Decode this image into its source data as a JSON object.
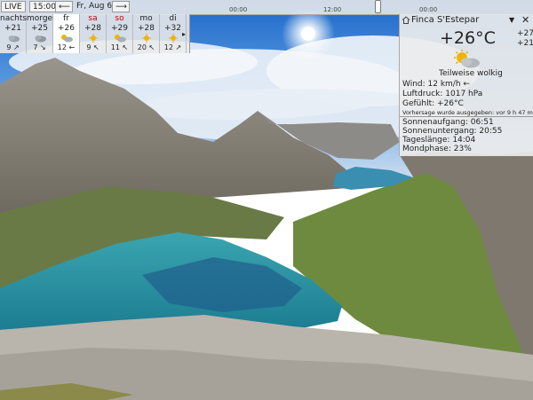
{
  "top": {
    "live_label": "LIVE",
    "time": "15:00",
    "prev_arrow": "⟵",
    "date": "Fr, Aug 6",
    "next_arrow": "⟶",
    "ticks": [
      "00:00",
      "12:00",
      "00:00"
    ]
  },
  "forecast": [
    {
      "name": "nachts",
      "temp": "+21",
      "wind_speed": "9",
      "wind_dir": "↗",
      "icon": "cloud-icon",
      "weekend": false,
      "selected": false
    },
    {
      "name": "morgen",
      "temp": "+25",
      "wind_speed": "7",
      "wind_dir": "↘",
      "icon": "cloud-icon",
      "weekend": false,
      "selected": false
    },
    {
      "name": "fr",
      "temp": "+26",
      "wind_speed": "12",
      "wind_dir": "←",
      "icon": "partly-cloudy-icon",
      "weekend": false,
      "selected": true
    },
    {
      "name": "sa",
      "temp": "+28",
      "wind_speed": "9",
      "wind_dir": "↖",
      "icon": "sun-icon",
      "weekend": true,
      "selected": false
    },
    {
      "name": "so",
      "temp": "+29",
      "wind_speed": "11",
      "wind_dir": "↖",
      "icon": "partly-cloudy-icon",
      "weekend": true,
      "selected": false
    },
    {
      "name": "mo",
      "temp": "+28",
      "wind_speed": "20",
      "wind_dir": "↖",
      "icon": "sun-icon",
      "weekend": false,
      "selected": false
    },
    {
      "name": "di",
      "temp": "+32",
      "wind_speed": "12",
      "wind_dir": "↗",
      "icon": "sun-icon",
      "weekend": false,
      "selected": false
    }
  ],
  "forecast_more": "▸",
  "panel": {
    "location": "Finca S'Estepar",
    "temp": "+26°C",
    "side_high": "+27",
    "side_low": "+21",
    "condition": "Teilweise wolkig",
    "wind": "Wind:  12 km/h  ←",
    "pressure": "Luftdruck:  1017 hPa",
    "felt": "Gefühlt:  +26°C",
    "note": "Vorhersage wurde ausgegeben:  vor 9 h 47 mn",
    "sunrise": "Sonnenaufgang:  06:51",
    "sunset": "Sonnenuntergang:  20:55",
    "daylength": "Tageslänge:  14:04",
    "moon": "Mondphase:  23%"
  }
}
